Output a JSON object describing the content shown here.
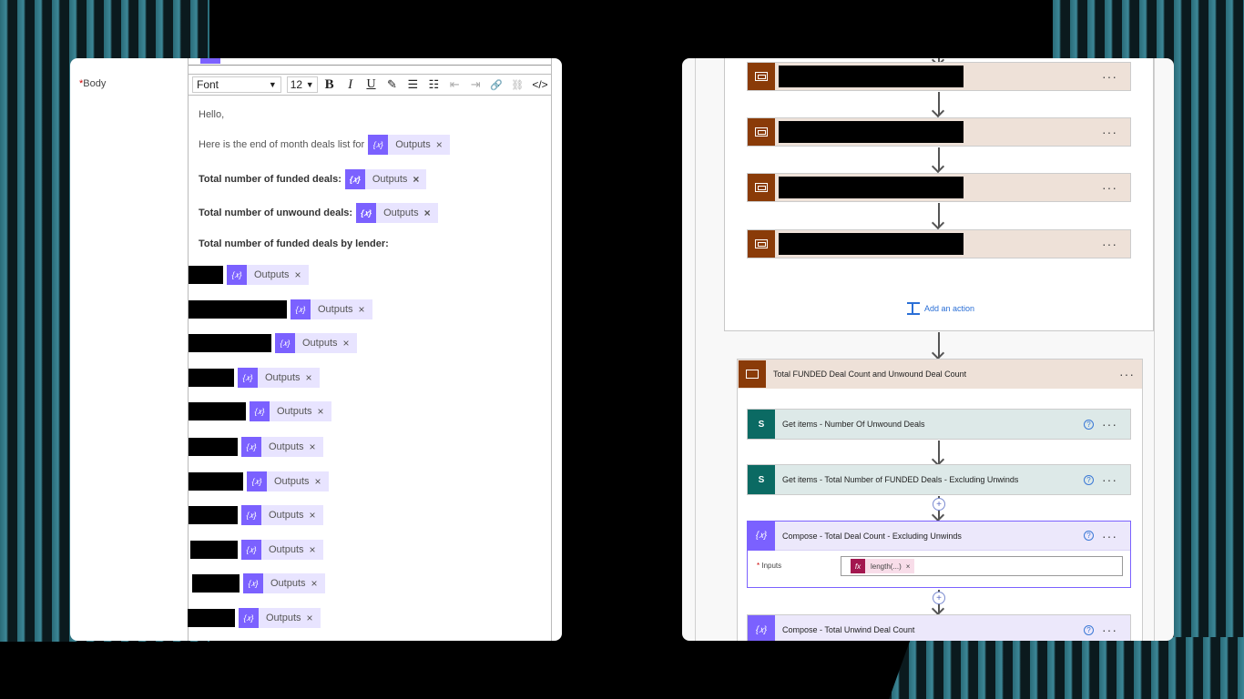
{
  "left_panel": {
    "body_label": "Body",
    "required_marker": "*",
    "toolbar": {
      "font": "Font",
      "font_arrow": "▼",
      "size": "12",
      "size_arrow": "▼",
      "bold": "B",
      "italic": "I",
      "underline": "U",
      "highlight": "✎",
      "bullets": "☰",
      "numbering": "☷",
      "outdent": "⇤",
      "indent": "⇥",
      "link": "🔗",
      "unlink": "⛓",
      "code": "</>"
    },
    "lines": {
      "greeting": "Hello,",
      "intro": "Here is the end of month deals list for",
      "funded": "Total number of funded deals:",
      "unwound": "Total number of unwound deals:",
      "by_lender": "Total number of funded deals by lender:"
    },
    "token_label": "Outputs",
    "token_icon": "{𝑥}",
    "token_remove": "×"
  },
  "right_panel": {
    "add_action": "Add an action",
    "dots": "···",
    "scope_title": "Total FUNDED Deal Count and Unwound Deal Count",
    "steps": [
      {
        "title": "Get items - Number Of Unwound Deals",
        "icon": "S"
      },
      {
        "title": "Get items - Total Number of FUNDED Deals - Excluding Unwinds",
        "icon": "S"
      },
      {
        "title": "Compose - Total Deal Count - Excluding Unwinds",
        "icon": "{𝑥}"
      },
      {
        "title": "Compose - Total Unwind Deal Count",
        "icon": "{𝑥}"
      }
    ],
    "help": "?",
    "plus": "+",
    "inputs_label": "Inputs",
    "fx_label": "fx",
    "fx_value": "length(...)",
    "fx_remove": "×"
  }
}
